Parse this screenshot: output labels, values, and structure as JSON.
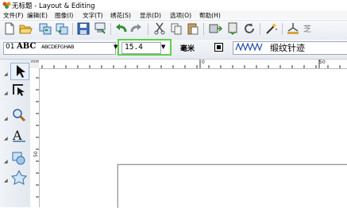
{
  "window": {
    "title": "无标题 - Layout & Editing"
  },
  "menu": {
    "items": [
      "文件(F)",
      "编辑(E)",
      "图像(I)",
      "文字(T)",
      "绣花(S)",
      "显示(D)",
      "选项(O)",
      "帮助(H)"
    ]
  },
  "toolbar": {
    "icons": [
      "new-file-icon",
      "open-folder-icon",
      "import-icon",
      "template-icon",
      "save-icon",
      "print-icon",
      "undo-icon",
      "redo-icon",
      "cut-icon",
      "copy-icon",
      "paste-icon",
      "transfer-icon",
      "write-card-icon",
      "rotate-icon",
      "magic-wand-icon",
      "design-center-icon",
      "more-icon"
    ]
  },
  "properties": {
    "font_number": "01",
    "font_sample": "ABC",
    "font_preview": "ABCDEFGHAB",
    "size_value": "15.4",
    "size_unit": "毫米",
    "stitch_type": "缎纹针迹"
  },
  "tools": [
    "select-arrow-icon",
    "point-edit-icon",
    "zoom-icon",
    "text-tool-icon",
    "shape-tool-icon",
    "stitch-tool-icon"
  ],
  "rulers": {
    "h_labels": [
      "mm",
      "0",
      "50"
    ],
    "v_labels": [
      "50"
    ]
  },
  "colors": {
    "highlight": "#5cd048",
    "toolbar_bg": "#eef1f5"
  }
}
